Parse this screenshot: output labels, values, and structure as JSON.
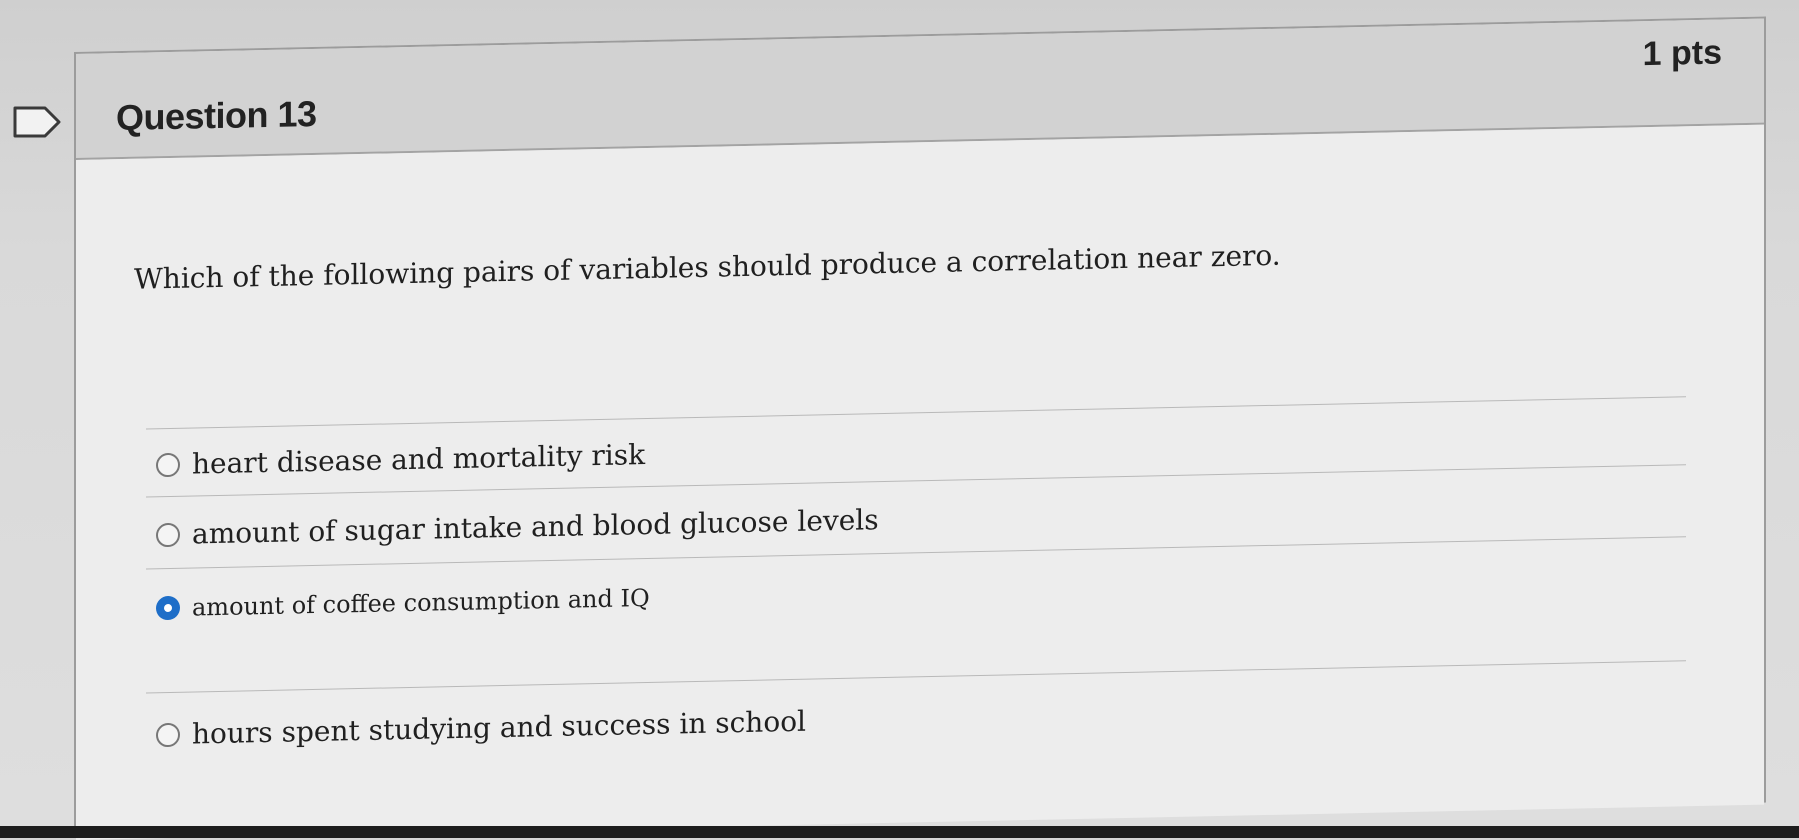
{
  "question": {
    "title": "Question 13",
    "points": "1 pts",
    "prompt": "Which of the following pairs of variables should produce a correlation near zero.",
    "answers": [
      {
        "label": "heart disease and mortality risk",
        "selected": false
      },
      {
        "label": "amount of sugar intake and blood glucose levels",
        "selected": false
      },
      {
        "label": "amount of coffee consumption and IQ",
        "selected": true
      },
      {
        "label": "hours spent studying and success in school",
        "selected": false
      }
    ]
  },
  "colors": {
    "selected_radio": "#1e6ec8",
    "header_bg": "#d2d2d2",
    "card_bg": "#ededed"
  },
  "icons": {
    "bookmark": "bookmark-flag-icon"
  }
}
